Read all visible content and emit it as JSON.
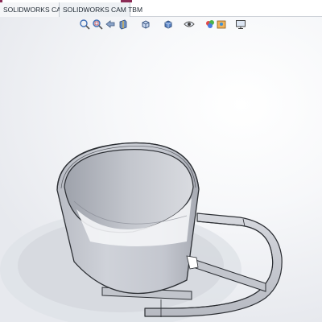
{
  "tabs": [
    {
      "label": "SOLIDWORKS CAM"
    },
    {
      "label": "SOLIDWORKS CAM TBM"
    }
  ],
  "toolbar": {
    "icons": [
      "zoom-to-fit-icon",
      "zoom-to-area-icon",
      "previous-view-icon",
      "section-view-icon",
      "view-orientation-icon",
      "display-style-icon",
      "hide-show-items-icon",
      "edit-appearance-icon",
      "apply-scene-icon",
      "view-settings-icon"
    ]
  },
  "colors": {
    "part_body": "#c9ccd3",
    "part_edge": "#2b2e33",
    "tab_accent": "#8a2b55"
  }
}
